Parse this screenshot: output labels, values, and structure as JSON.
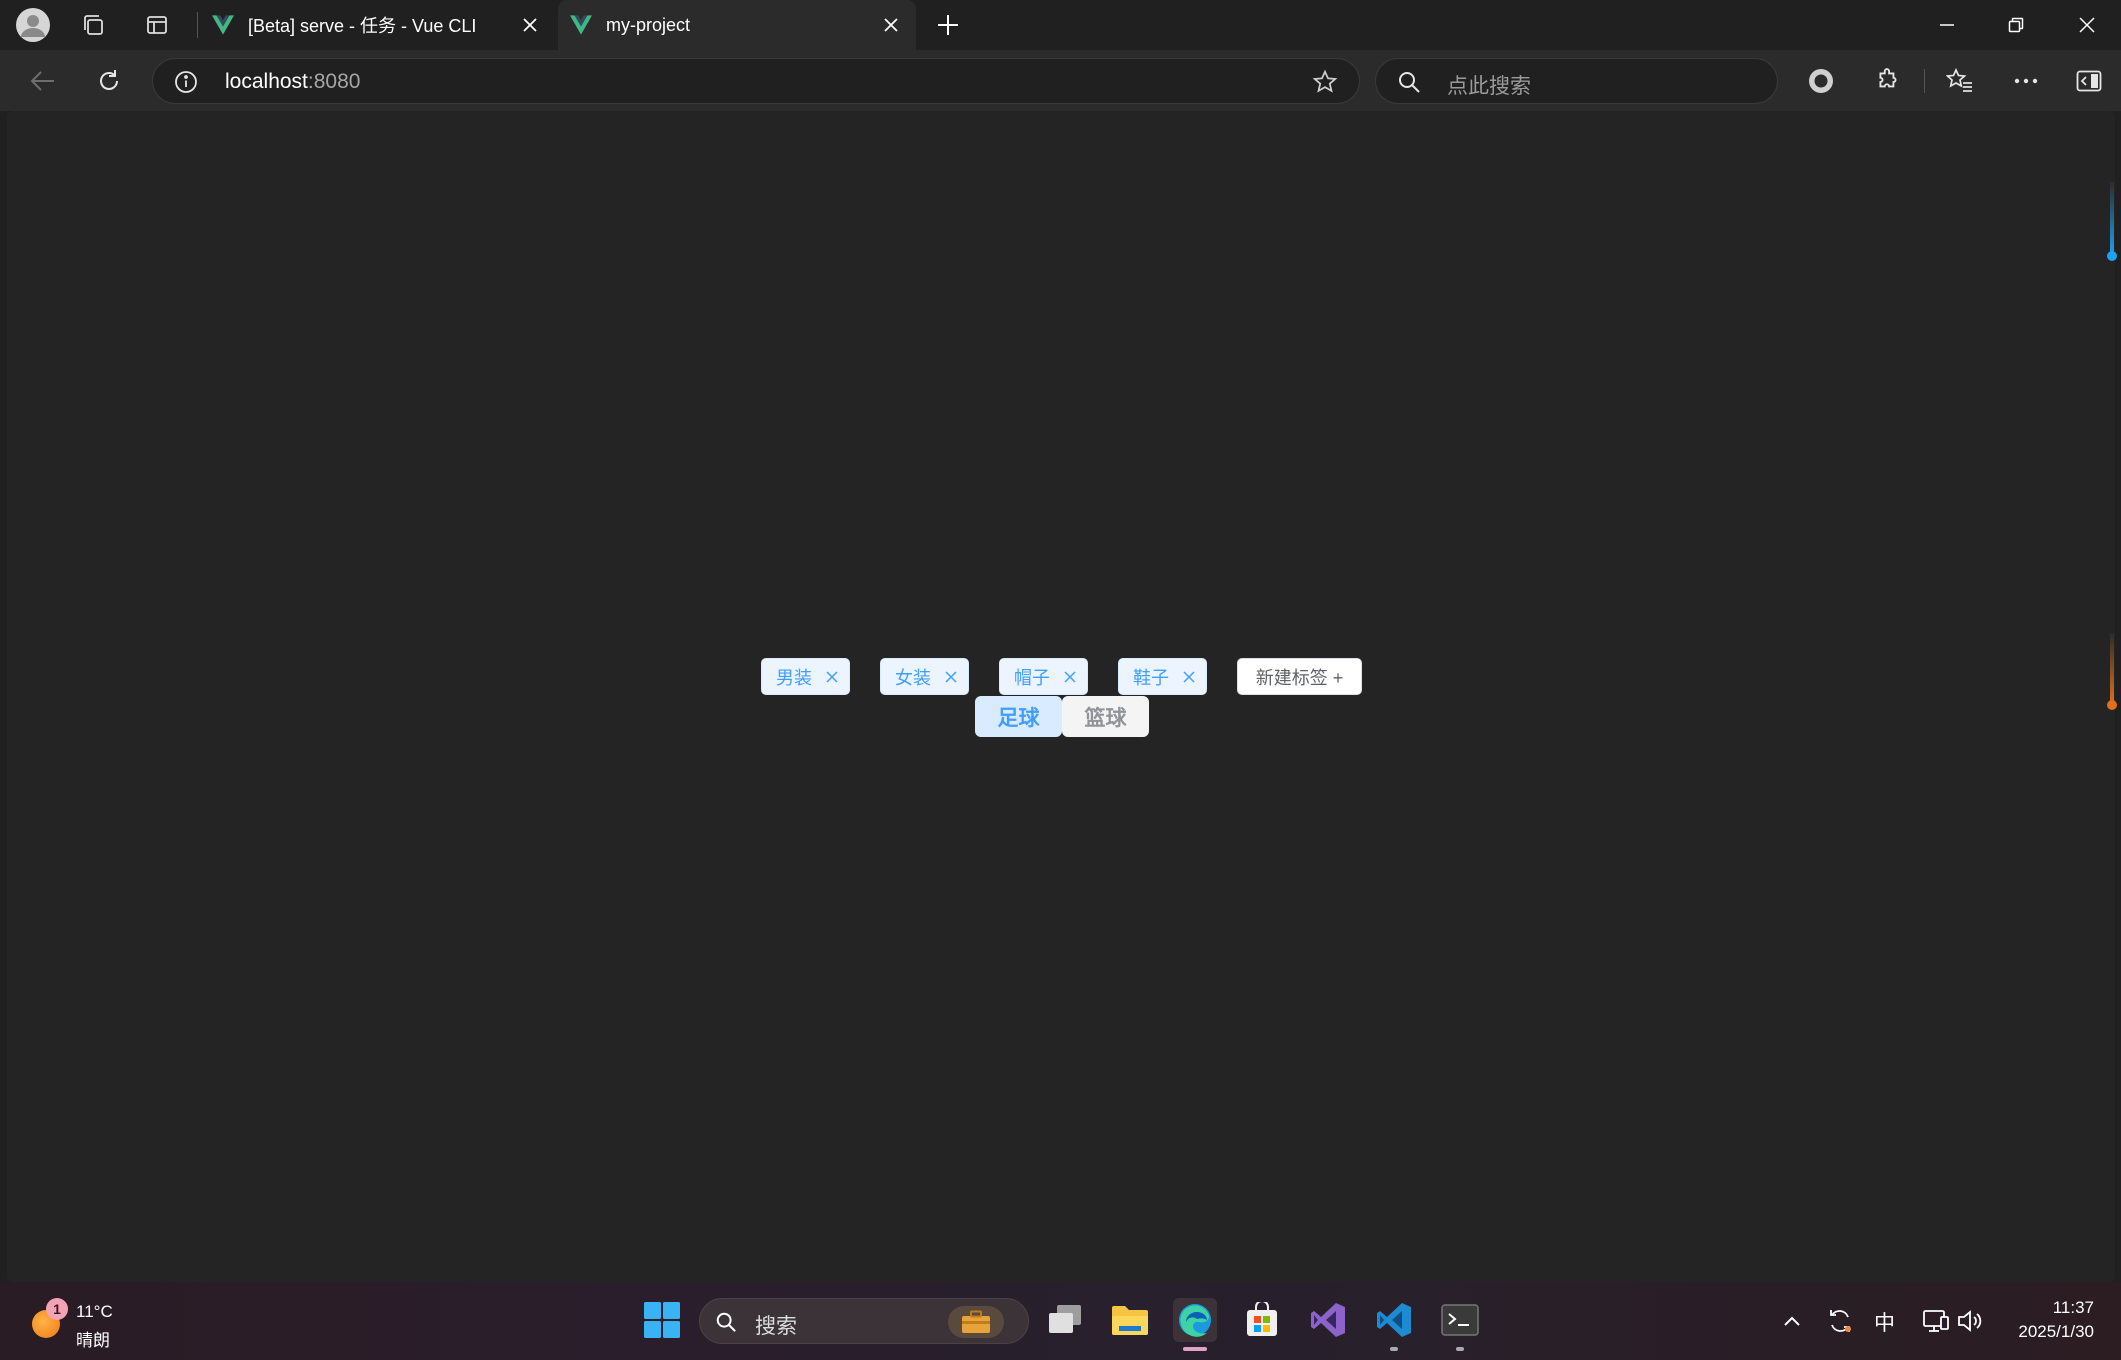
{
  "browser": {
    "tabs": [
      {
        "title": "[Beta] serve - 任务 - Vue CLI"
      },
      {
        "title": "my-project"
      }
    ],
    "address": {
      "host": "localhost",
      "port": ":8080"
    },
    "search": {
      "placeholder": "点此搜索"
    }
  },
  "page": {
    "tags": [
      {
        "label": "男装"
      },
      {
        "label": "女装"
      },
      {
        "label": "帽子"
      },
      {
        "label": "鞋子"
      }
    ],
    "new_tag_label": "新建标签 +",
    "segments": [
      {
        "label": "足球",
        "selected": true
      },
      {
        "label": "篮球",
        "selected": false
      }
    ],
    "accent_color": "#409eff"
  },
  "taskbar": {
    "weather": {
      "temp": "11°C",
      "condition": "晴朗",
      "badge": "1"
    },
    "search_placeholder": "搜索",
    "ime": "中",
    "time": "11:37",
    "date": "2025/1/30"
  }
}
